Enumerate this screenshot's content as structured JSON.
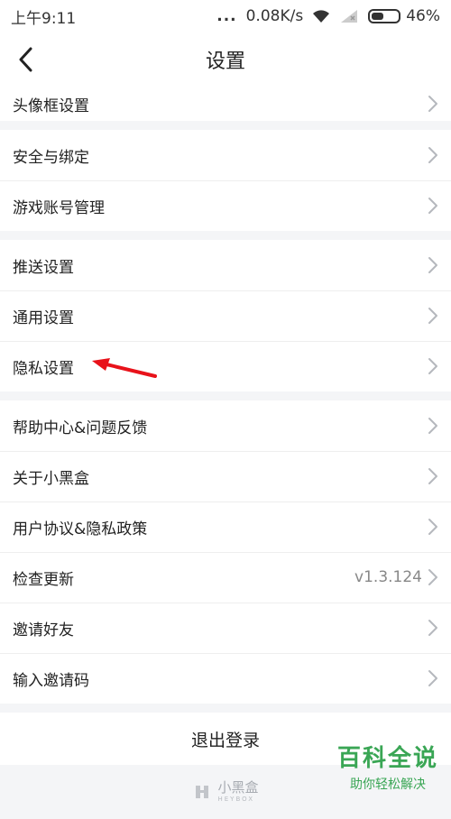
{
  "status": {
    "time": "上午9:11",
    "dots": "...",
    "speed": "0.08K/s",
    "battery": "46%",
    "battery_level": 0.46
  },
  "header": {
    "title": "设置"
  },
  "groups": [
    {
      "items": [
        {
          "label": "头像框设置"
        }
      ]
    },
    {
      "items": [
        {
          "label": "安全与绑定"
        },
        {
          "label": "游戏账号管理"
        }
      ]
    },
    {
      "items": [
        {
          "label": "推送设置"
        },
        {
          "label": "通用设置"
        },
        {
          "label": "隐私设置"
        }
      ]
    },
    {
      "items": [
        {
          "label": "帮助中心&问题反馈"
        },
        {
          "label": "关于小黑盒"
        },
        {
          "label": "用户协议&隐私政策"
        },
        {
          "label": "检查更新",
          "value": "v1.3.124"
        },
        {
          "label": "邀请好友"
        },
        {
          "label": "输入邀请码"
        }
      ]
    }
  ],
  "logout": {
    "label": "退出登录"
  },
  "footer": {
    "brand_cn": "小黑盒",
    "brand_en": "HEYBOX"
  },
  "watermark": {
    "title": "百科全说",
    "subtitle": "助你轻松解决"
  },
  "colors": {
    "accent": "#3aa655",
    "arrow": "#e8121a"
  }
}
